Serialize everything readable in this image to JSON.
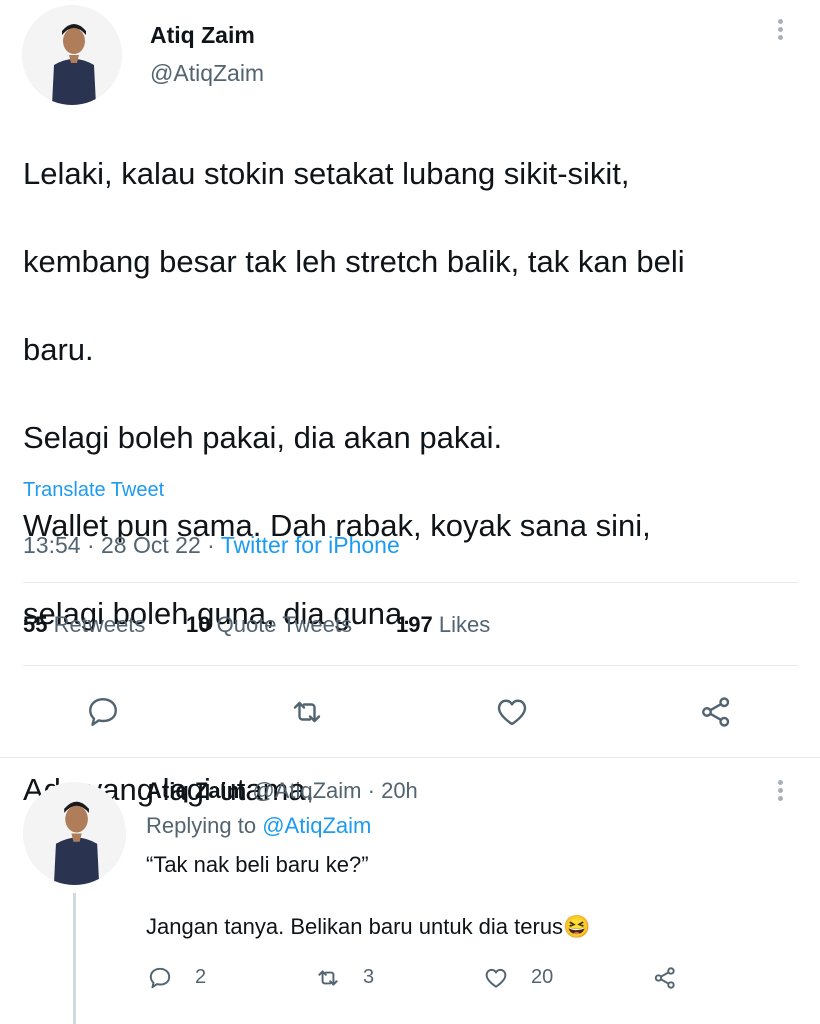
{
  "main_tweet": {
    "author_name": "Atiq Zaim",
    "handle": "@AtiqZaim",
    "lines": [
      "Lelaki, kalau stokin setakat lubang sikit-sikit,",
      "kembang besar tak leh stretch balik, tak kan beli",
      "baru.",
      "Selagi boleh pakai, dia akan pakai.",
      "Wallet pun sama. Dah rabak, koyak sana sini,",
      "selagi boleh guna, dia guna.",
      "",
      "Ada yang lagi utama."
    ],
    "translate_label": "Translate Tweet",
    "time": "13:54",
    "date": "28 Oct 22",
    "source": "Twitter for iPhone",
    "retweets_count": "55",
    "retweets_label": "Retweets",
    "quotes_count": "10",
    "quotes_label": "Quote Tweets",
    "likes_count": "197",
    "likes_label": "Likes"
  },
  "reply": {
    "author_name": "Atiq Zaim",
    "handle": "@AtiqZaim",
    "age": "20h",
    "replying_prefix": "Replying to",
    "replying_handle": "@AtiqZaim",
    "line1": "“Tak nak beli baru ke?”",
    "line2": "Jangan tanya. Belikan baru untuk dia terus",
    "emoji": "😆",
    "reply_count": "2",
    "retweet_count": "3",
    "like_count": "20"
  },
  "colors": {
    "accent": "#1d9bf0",
    "muted": "#536471",
    "text": "#0f1419"
  },
  "icons": [
    "more-icon",
    "reply-icon",
    "retweet-icon",
    "like-icon",
    "share-icon"
  ]
}
